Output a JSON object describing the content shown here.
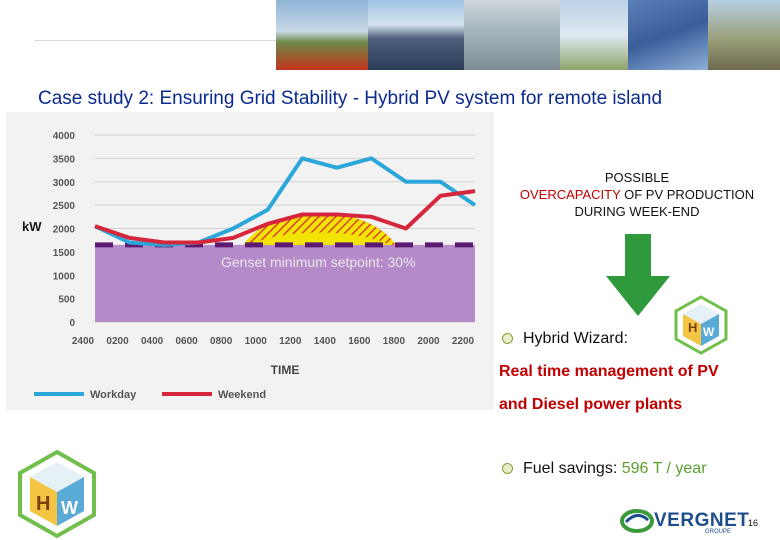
{
  "slide": {
    "title": "Case study 2: Ensuring Grid Stability - Hybrid PV system for remote island",
    "page_number": "16"
  },
  "note": {
    "line1": "POSSIBLE",
    "line2_red": "OVERCAPACITY",
    "line2_rest": " OF PV PRODUCTION",
    "line3": "DURING WEEK-END"
  },
  "bullets": {
    "hybrid_label": "Hybrid Wizard:",
    "hybrid_desc_1": "Real time management of PV",
    "hybrid_desc_2": "and Diesel power plants",
    "fuel_label": "Fuel savings: ",
    "fuel_value": "596 T / year"
  },
  "brand": {
    "vergnet": "VERGNET",
    "vergnet_sub": "GROUPE"
  },
  "colors": {
    "title": "#0b2a8f",
    "workday": "#2aa6d9",
    "weekend": "#d6263b",
    "genset_fill": "#b58ac9",
    "pv_fill": "#f2e400",
    "setpoint": "#5c1a73",
    "accent_red": "#c00000",
    "accent_green": "#5aa02c"
  },
  "chart_data": {
    "type": "line",
    "ylabel": "kW",
    "xlabel": "TIME",
    "ylim": [
      0,
      4000
    ],
    "yticks": [
      0,
      500,
      1000,
      1500,
      2000,
      2500,
      3000,
      3500,
      4000
    ],
    "x": [
      "2400",
      "0200",
      "0400",
      "0600",
      "0800",
      "1000",
      "1200",
      "1400",
      "1600",
      "1800",
      "2000",
      "2200"
    ],
    "series": [
      {
        "name": "Workday",
        "values": [
          2050,
          1700,
          1650,
          1700,
          2000,
          2400,
          3500,
          3300,
          3500,
          3000,
          3000,
          2500
        ]
      },
      {
        "name": "Weekend",
        "values": [
          2050,
          1800,
          1700,
          1700,
          1800,
          2100,
          2300,
          2300,
          2250,
          2000,
          2700,
          2800
        ]
      }
    ],
    "genset_setpoint_kw": 1650,
    "genset_label": "Genset minimum setpoint: 30%",
    "legend": "bottom",
    "grid": true
  }
}
